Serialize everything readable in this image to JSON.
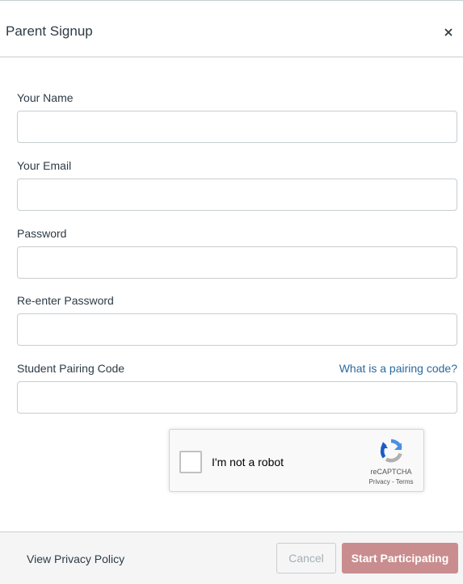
{
  "dialog": {
    "title": "Parent Signup"
  },
  "form": {
    "name_label": "Your Name",
    "name_value": "",
    "email_label": "Your Email",
    "email_value": "",
    "password_label": "Password",
    "password_value": "",
    "confirm_password_label": "Re-enter Password",
    "confirm_password_value": "",
    "pairing_code_label": "Student Pairing Code",
    "pairing_code_value": "",
    "pairing_code_help": "What is a pairing code?"
  },
  "recaptcha": {
    "label": "I'm not a robot",
    "brand": "reCAPTCHA",
    "privacy": "Privacy",
    "separator": " - ",
    "terms": "Terms",
    "checked": false
  },
  "footer": {
    "privacy_link": "View Privacy Policy",
    "cancel_label": "Cancel",
    "submit_label": "Start Participating"
  },
  "colors": {
    "link": "#2b6a9e",
    "submit_disabled": "#c98d8f",
    "border": "#c7cdd1",
    "text": "#2d3b45"
  },
  "icons": {
    "close": "close-icon",
    "recaptcha": "recaptcha-logo-icon"
  }
}
